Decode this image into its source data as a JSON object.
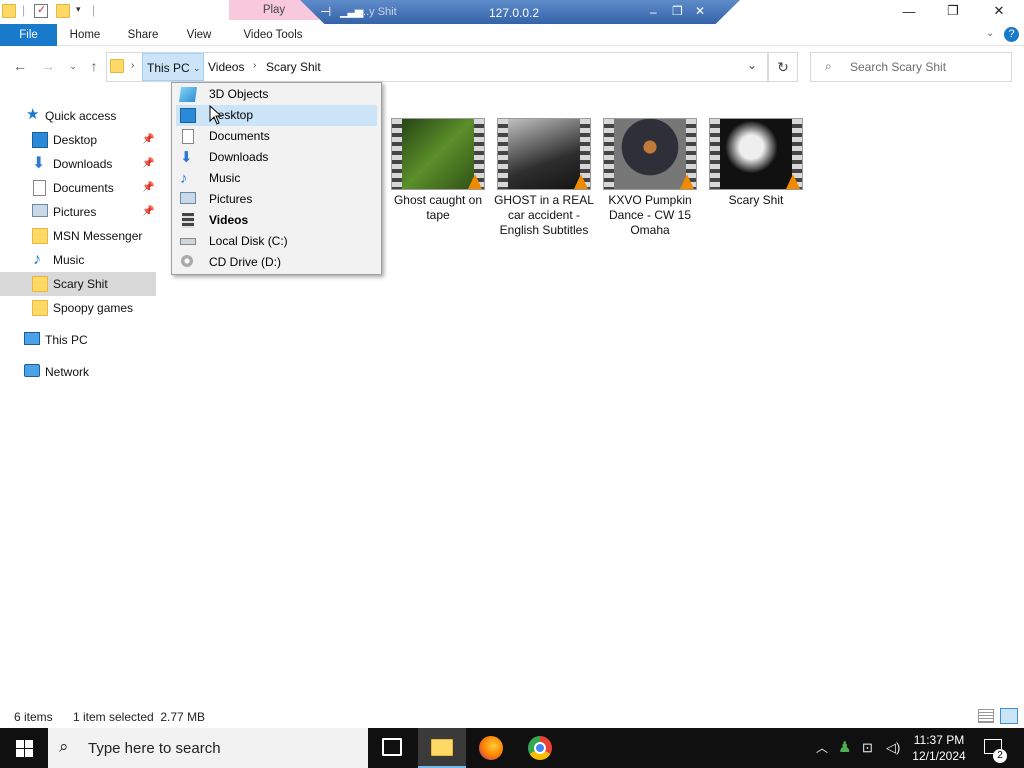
{
  "title_bar": {
    "ctx_tab": "Play",
    "remote_host": "127.0.0.2",
    "remote_under_title": "...y Shit",
    "minimize": "—",
    "maximize": "❐",
    "close": "✕"
  },
  "ribbon": {
    "tabs": [
      "File",
      "Home",
      "Share",
      "View",
      "Video Tools"
    ]
  },
  "address": {
    "crumbs": [
      "This PC",
      "Videos",
      "Scary Shit"
    ],
    "search_placeholder": "Search Scary Shit"
  },
  "dropdown": {
    "items": [
      "3D Objects",
      "Desktop",
      "Documents",
      "Downloads",
      "Music",
      "Pictures",
      "Videos",
      "Local Disk (C:)",
      "CD Drive (D:)"
    ],
    "highlighted": "Desktop",
    "bold": "Videos"
  },
  "sidebar": {
    "quick_access": "Quick access",
    "items": [
      "Desktop",
      "Downloads",
      "Documents",
      "Pictures",
      "MSN Messenger",
      "Music",
      "Scary Shit",
      "Spoopy games"
    ],
    "this_pc": "This PC",
    "network": "Network"
  },
  "files": [
    {
      "name": "Ghost caught on tape"
    },
    {
      "name": "GHOST in a REAL car accident - English Subtitles"
    },
    {
      "name": "KXVO Pumpkin Dance - CW 15 Omaha"
    },
    {
      "name": "Scary Shit"
    }
  ],
  "status_bar": {
    "count": "6 items",
    "selection": "1 item selected  2.77 MB"
  },
  "taskbar": {
    "search_placeholder": "Type here to search",
    "time": "11:37 PM",
    "date": "12/1/2024",
    "notification_count": "2"
  }
}
